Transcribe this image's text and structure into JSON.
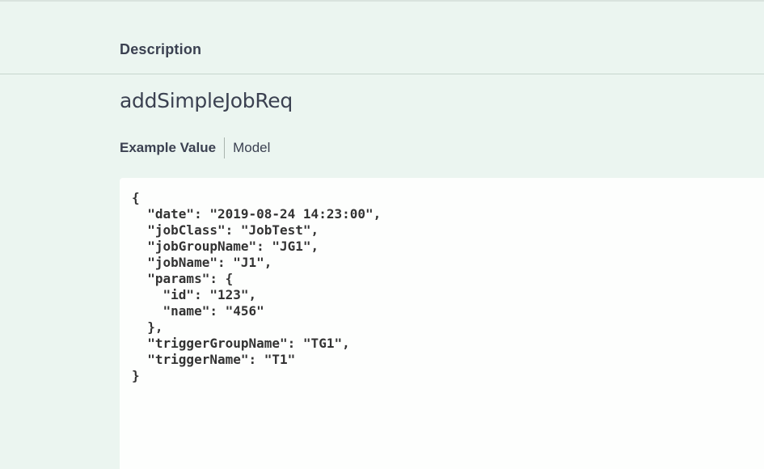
{
  "header": {
    "title": "Description"
  },
  "schema": {
    "name": "addSimpleJobReq"
  },
  "tabs": {
    "example_label": "Example Value",
    "model_label": "Model"
  },
  "example": {
    "code": "{\n  \"date\": \"2019-08-24 14:23:00\",\n  \"jobClass\": \"JobTest\",\n  \"jobGroupName\": \"JG1\",\n  \"jobName\": \"J1\",\n  \"params\": {\n    \"id\": \"123\",\n    \"name\": \"456\"\n  },\n  \"triggerGroupName\": \"TG1\",\n  \"triggerName\": \"T1\"\n}"
  },
  "colors": {
    "background": "#ebf5f0",
    "text": "#3b4151",
    "code_background": "#fdfefd"
  }
}
